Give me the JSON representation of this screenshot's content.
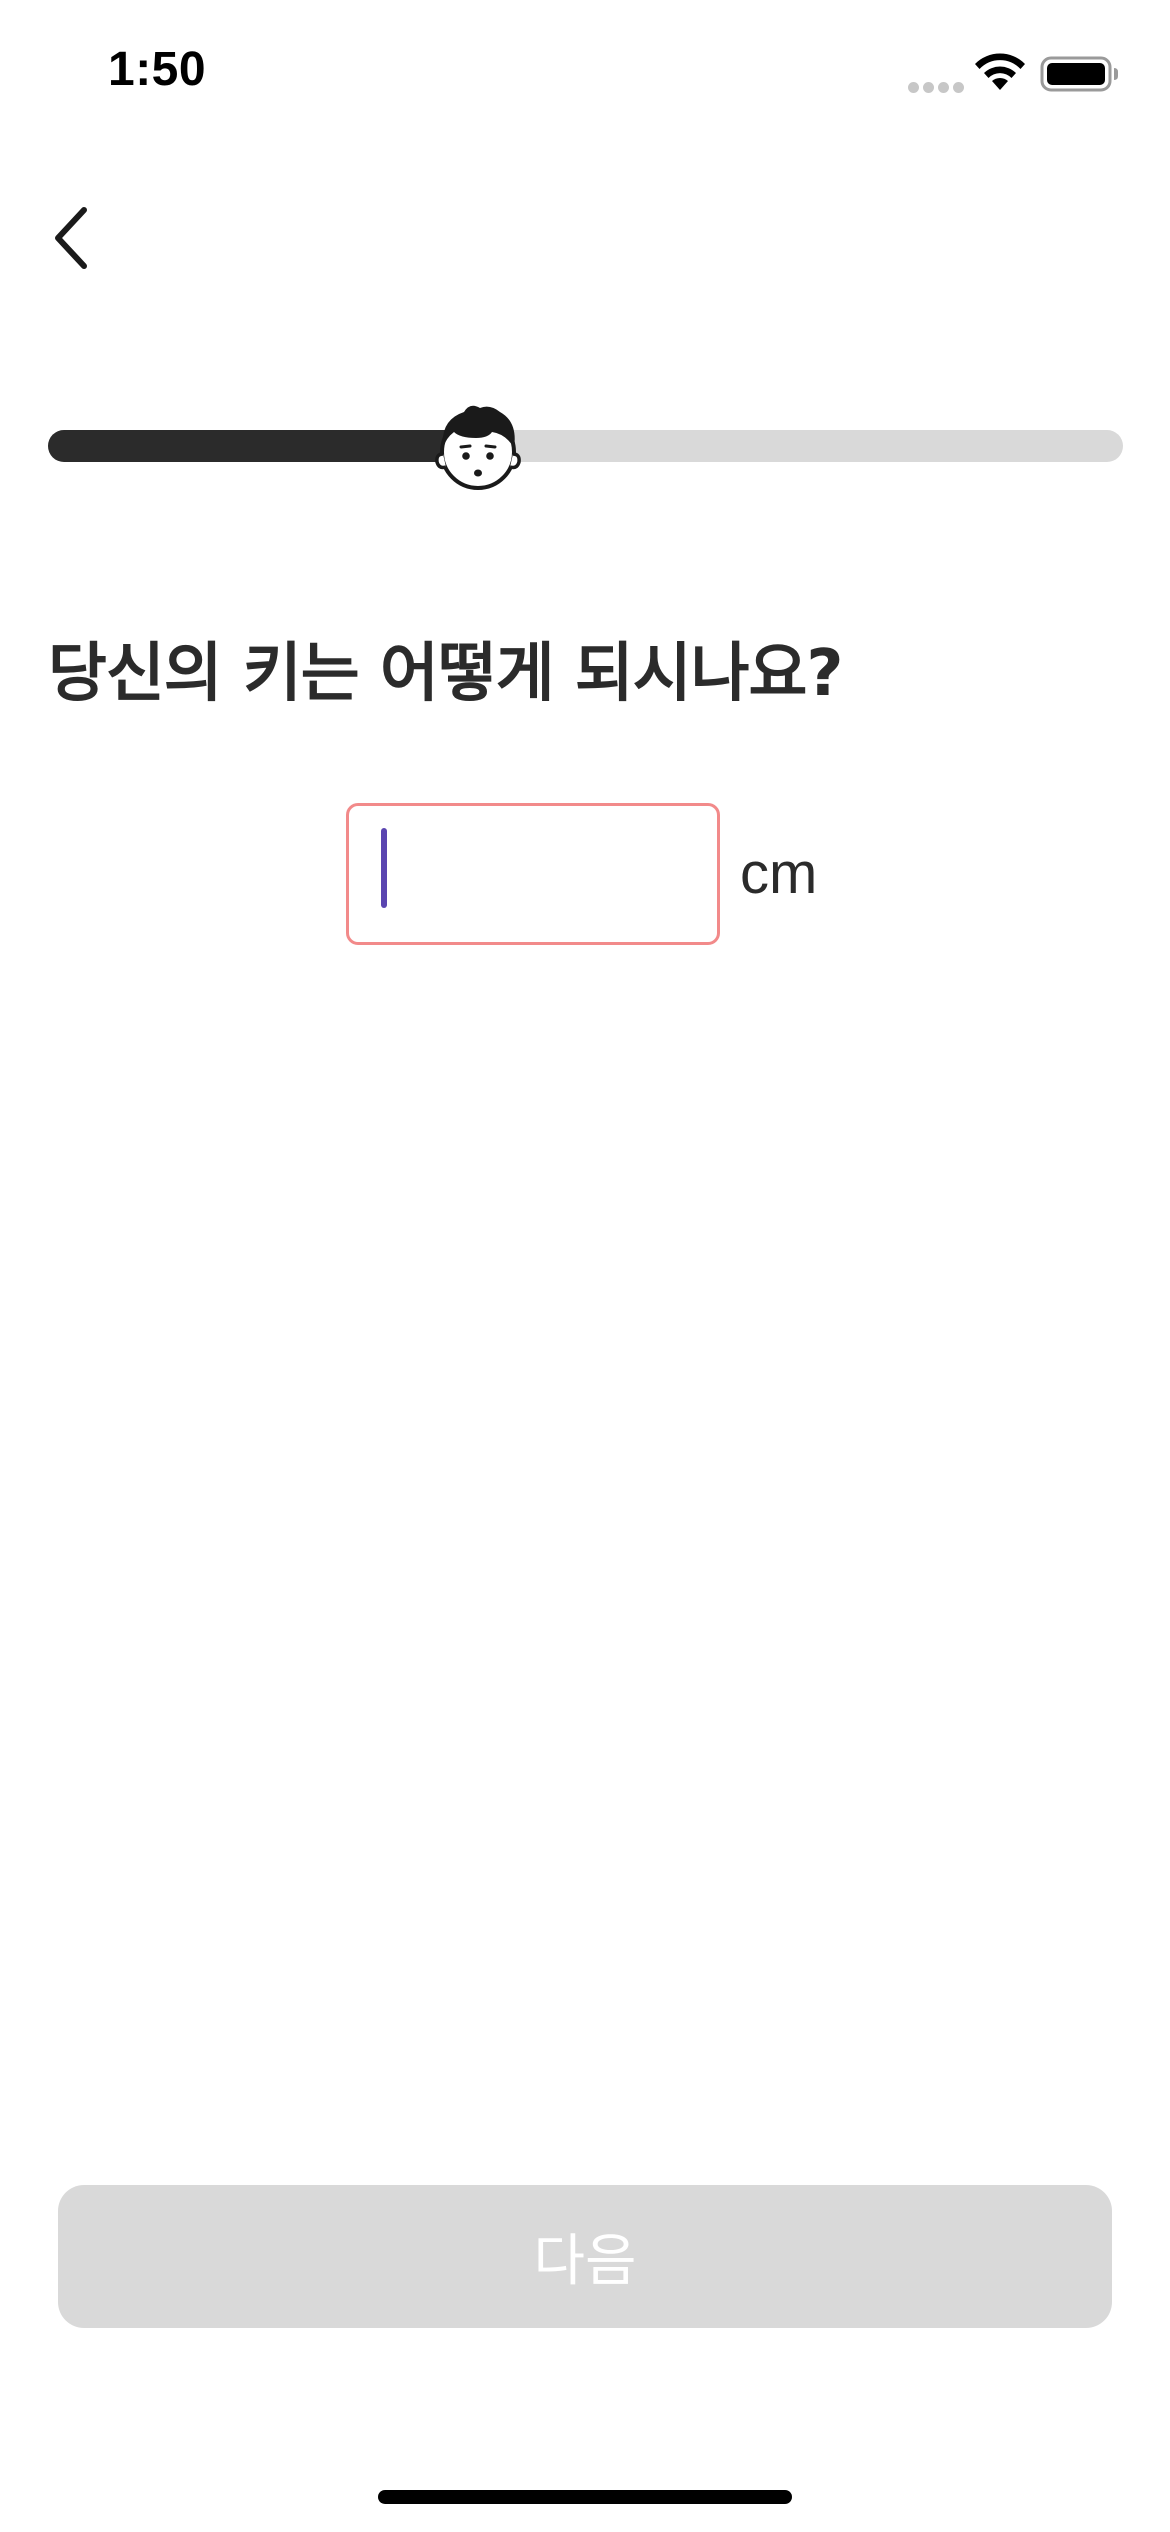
{
  "status_bar": {
    "time": "1:50",
    "icons": [
      "cellular-signal-icon",
      "wifi-icon",
      "battery-icon"
    ]
  },
  "navigation": {
    "back_icon": "chevron-left-icon"
  },
  "progress": {
    "fraction": 0.4,
    "avatar_icon": "boy-face-icon",
    "fill_color": "#2b2b2b",
    "track_color": "#d9d9d9"
  },
  "question": {
    "title": "당신의 키는 어떻게 되시나요?"
  },
  "height_input": {
    "value": "",
    "placeholder": "",
    "unit": "cm",
    "border_color": "#f28a8a",
    "caret_color": "#5a45b0"
  },
  "next_button": {
    "label": "다음",
    "enabled": false,
    "background_color": "#d9d9d9"
  }
}
